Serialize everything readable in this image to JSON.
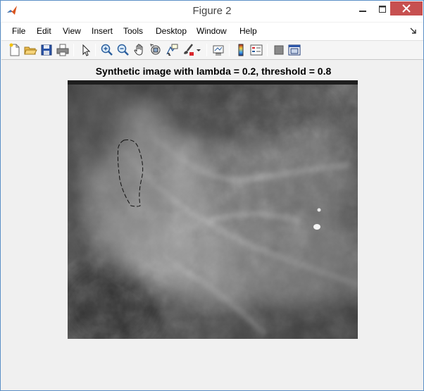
{
  "window": {
    "title": "Figure 2"
  },
  "menu": {
    "items": [
      "File",
      "Edit",
      "View",
      "Insert",
      "Tools",
      "Desktop",
      "Window",
      "Help"
    ]
  },
  "toolbar": {
    "icons": [
      "new-figure-icon",
      "open-file-icon",
      "save-figure-icon",
      "print-figure-icon",
      "edit-plot-icon",
      "zoom-in-icon",
      "zoom-out-icon",
      "pan-icon",
      "rotate-3d-icon",
      "data-cursor-icon",
      "brush-icon",
      "brush-dropdown-icon",
      "link-plot-icon",
      "insert-colorbar-icon",
      "insert-legend-icon",
      "hide-plot-tools-icon",
      "show-plot-tools-icon"
    ]
  },
  "figure": {
    "title": "Synthetic image with lambda = 0.2, threshold = 0.8"
  },
  "colors": {
    "title_bar": "#ffffff",
    "close_button": "#c75050",
    "figure_background": "#f0f0f0",
    "border": "#5b8fc7"
  }
}
